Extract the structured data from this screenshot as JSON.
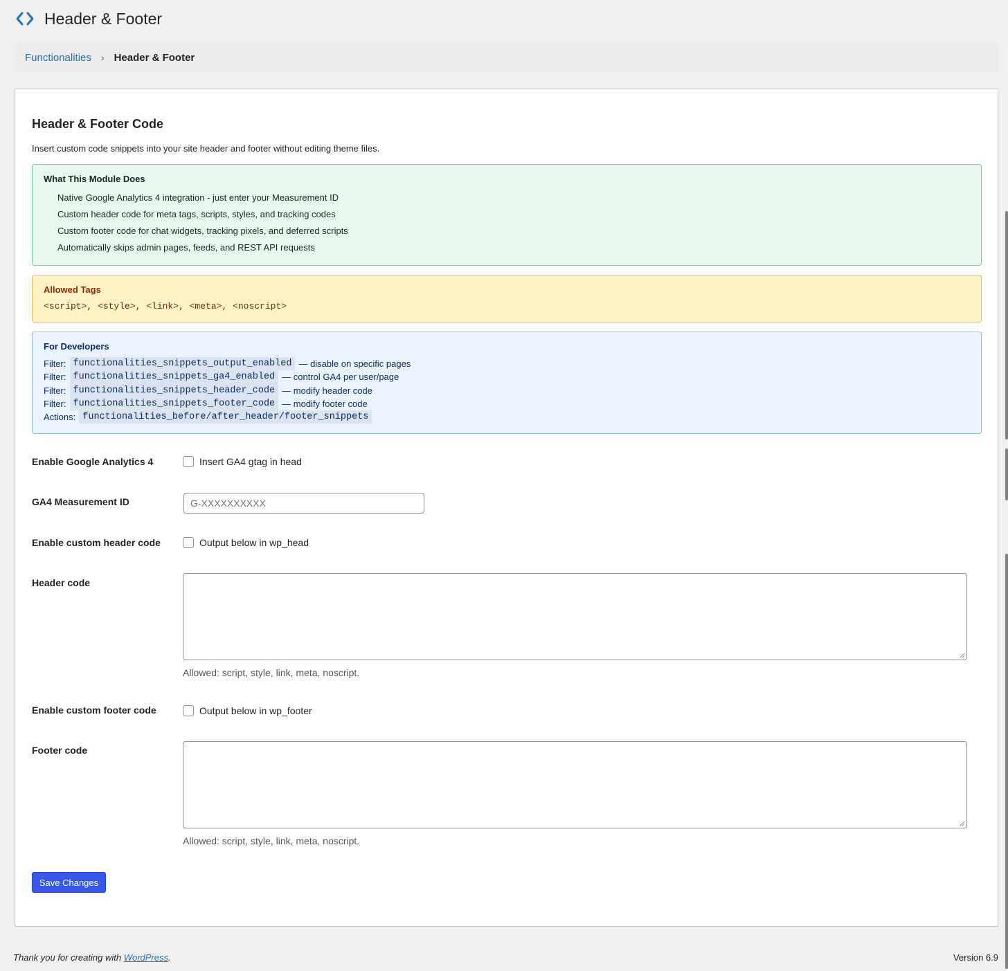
{
  "header": {
    "icon": "code-brackets-icon",
    "title": "Header & Footer"
  },
  "breadcrumb": {
    "parent": "Functionalities",
    "separator": "›",
    "current": "Header & Footer"
  },
  "card": {
    "title": "Header & Footer Code",
    "intro": "Insert custom code snippets into your site header and footer without editing theme files.",
    "module_box": {
      "title": "What This Module Does",
      "items": [
        "Native Google Analytics 4 integration - just enter your Measurement ID",
        "Custom header code for meta tags, scripts, styles, and tracking codes",
        "Custom footer code for chat widgets, tracking pixels, and deferred scripts",
        "Automatically skips admin pages, feeds, and REST API requests"
      ]
    },
    "tags_box": {
      "title": "Allowed Tags",
      "tags": "<script>, <style>, <link>, <meta>, <noscript>"
    },
    "dev_box": {
      "title": "For Developers",
      "lines": [
        {
          "prefix": "Filter:",
          "code": "functionalities_snippets_output_enabled",
          "suffix": "— disable on specific pages"
        },
        {
          "prefix": "Filter:",
          "code": "functionalities_snippets_ga4_enabled",
          "suffix": "— control GA4 per user/page"
        },
        {
          "prefix": "Filter:",
          "code": "functionalities_snippets_header_code",
          "suffix": "— modify header code"
        },
        {
          "prefix": "Filter:",
          "code": "functionalities_snippets_footer_code",
          "suffix": "— modify footer code"
        },
        {
          "prefix": "Actions:",
          "code": "functionalities_before/after_header/footer_snippets",
          "suffix": ""
        }
      ]
    }
  },
  "form": {
    "ga4_label": "Enable Google Analytics 4",
    "ga4_check_label": "Insert GA4 gtag in head",
    "ga4_id_label": "GA4 Measurement ID",
    "ga4_id_placeholder": "G-XXXXXXXXXX",
    "header_enable_label": "Enable custom header code",
    "header_check_label": "Output below in wp_head",
    "header_code_label": "Header code",
    "header_hint": "Allowed: script, style, link, meta, noscript.",
    "footer_enable_label": "Enable custom footer code",
    "footer_check_label": "Output below in wp_footer",
    "footer_code_label": "Footer code",
    "footer_hint": "Allowed: script, style, link, meta, noscript.",
    "save_label": "Save Changes"
  },
  "footer": {
    "thanks_prefix": "Thank you for creating with ",
    "thanks_link": "WordPress",
    "thanks_suffix": ".",
    "version": "Version 6.9"
  },
  "colors": {
    "accent": "#2271b1",
    "primary_button": "#3858e9"
  }
}
